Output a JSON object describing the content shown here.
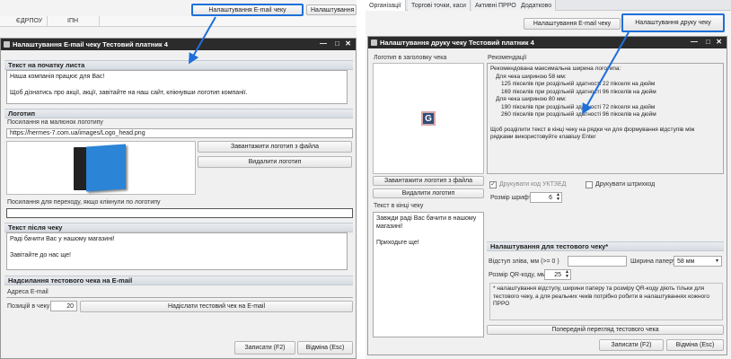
{
  "left": {
    "bg_headers": [
      "ЄДРПОУ",
      "ІПН"
    ],
    "top_buttons": [
      "Налаштування E-mail чеку",
      "Налаштування друку"
    ],
    "dialog_title": "Налаштування E-mail чеку  Тестовий платник 4",
    "section_begin": {
      "title": "Текст на початку листа",
      "lines": [
        "Наша компанія працює для Вас!",
        "",
        "Щоб дізнатись про акції, акції, завітайте на наш сайт, клікнувши логотип компанії."
      ]
    },
    "section_logo": {
      "title": "Логотип",
      "url_label": "Посилання на малюнок логотипу",
      "url_value": "https://hermes-7.com.ua/images/Logo_head.png",
      "btn_load": "Завантажити логотип з файла",
      "btn_delete": "Видалити логотип",
      "link_label": "Посилання для переходу, якщо клікнули по логотипу",
      "link_value": ""
    },
    "section_after": {
      "title": "Текст після чеку",
      "lines": [
        "Раді бачити Вас у нашому магазині!",
        "",
        "Завітайте до нас ще!"
      ]
    },
    "section_send": {
      "title": "Надсилання тестового чека на E-mail",
      "email_label": "Адреса E-mail",
      "email_value": "",
      "pos_label": "Позицій в чеку",
      "pos_value": "20",
      "send_btn": "Надіслати тестовий чек на E-mail"
    },
    "footer": {
      "save": "Записати (F2)",
      "cancel": "Відміна (Esc)"
    }
  },
  "right": {
    "tabs": [
      "Організації",
      "Торгові точки, каси",
      "Активні ПРРО",
      "Додатково"
    ],
    "top_buttons": [
      "Налаштування E-mail чеку",
      "Налаштування друку чеку"
    ],
    "dialog_title": "Налаштування друку чеку  Тестовий платник 4",
    "logo_label": "Логотип в заголовку чека",
    "logo_glyph": "G",
    "rec_label": "Рекомендації",
    "rec_lines": [
      "Рекомендована максимальна ширина логотипа:",
      "  Для чека шириною 58 мм:",
      "    125 пікселів при роздільній здатності 22 пікселя на дюйм",
      "    169 пікселів при роздільній здатності 96 пікселів на дюйм",
      "  Для чека шириною 80 мм:",
      "    190 пікселів при роздільній здатності 72 пікселя на дюйм",
      "    260 пікселів при роздільній здатності 96 пікселів на дюйм",
      "",
      "Щоб розділити текст в кінці чеку на рядки чи для формування відступів між",
      "рядками використовуйте клавішу Enter"
    ],
    "btn_load": "Завантажити логотип з файла",
    "btn_delete": "Видалити логотип",
    "chk_code": "Друкувати код УКТЗЕД",
    "chk_barcode": "Друкувати штрихкод",
    "font_label": "Розмір шрифта",
    "font_value": "6",
    "end_label": "Текст в кінці чеку",
    "end_lines": [
      "Завжди раді Вас бачити в нашому",
      "магазині!",
      "",
      "Приходьте ще!"
    ],
    "test_title": "Налаштування для тестового чеку*",
    "indent_label": "Відступ зліва, мм (>= 0 )",
    "indent_value": "",
    "paper_label": "Ширина паперу",
    "paper_value": "58 мм",
    "qr_label": "Розмір QR-коду, мм",
    "qr_value": "25",
    "note": "* налаштування відступу, ширини паперу та розміру QR-коду діють тільки для тестового чеку, а для реальних чеків потрібно робити в налаштуваннях кожного ПРРО",
    "preview_btn": "Попередній перегляд тестового чека",
    "footer": {
      "save": "Записати (F2)",
      "cancel": "Відміна (Esc)"
    }
  },
  "colors": {
    "accent": "#1e6fd9",
    "title_bar": "#2b2b2b",
    "section": "#dbe0e6",
    "logo_blue": "#2b84d6"
  }
}
